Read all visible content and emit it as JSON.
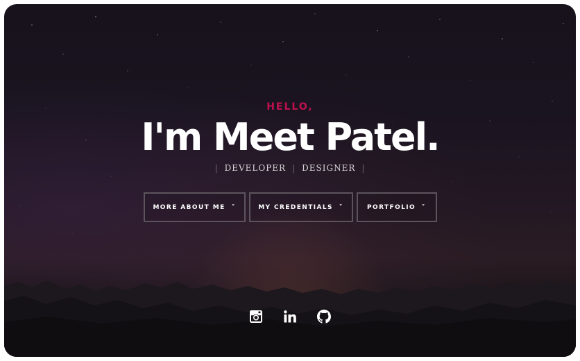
{
  "hero": {
    "greeting": "HELLO,",
    "name": "I'm Meet Patel.",
    "roles": [
      "DEVELOPER",
      "DESIGNER"
    ],
    "role_separator": "|"
  },
  "nav_buttons": [
    {
      "label": "MORE ABOUT ME",
      "icon": "chevron-down-icon"
    },
    {
      "label": "MY CREDENTIALS",
      "icon": "chevron-down-icon"
    },
    {
      "label": "PORTFOLIO",
      "icon": "chevron-down-icon"
    }
  ],
  "social_links": [
    {
      "name": "instagram",
      "icon": "instagram-icon"
    },
    {
      "name": "linkedin",
      "icon": "linkedin-icon"
    },
    {
      "name": "github",
      "icon": "github-icon"
    }
  ],
  "colors": {
    "accent": "#c0114f",
    "text": "#ffffff",
    "button_border": "#5c545c"
  }
}
